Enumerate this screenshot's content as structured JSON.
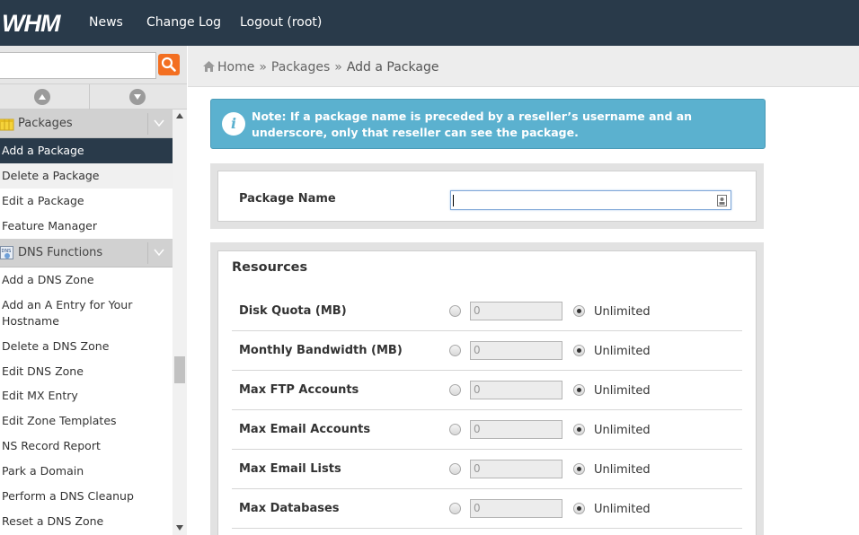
{
  "topbar": {
    "logo_text": "WHM",
    "nav": [
      "News",
      "Change Log",
      "Logout (root)"
    ]
  },
  "sidebar": {
    "search": {
      "value": "",
      "placeholder": ""
    },
    "groups": [
      {
        "label": "Packages",
        "icon": "packages-icon",
        "items": [
          "Add a Package",
          "Delete a Package",
          "Edit a Package",
          "Feature Manager"
        ]
      },
      {
        "label": "DNS Functions",
        "icon": "dns-icon",
        "icon_text": "DNS",
        "items": [
          "Add a DNS Zone",
          "Add an A Entry for Your Hostname",
          "Delete a DNS Zone",
          "Edit DNS Zone",
          "Edit MX Entry",
          "Edit Zone Templates",
          "NS Record Report",
          "Park a Domain",
          "Perform a DNS Cleanup",
          "Reset a DNS Zone"
        ]
      }
    ],
    "active_item": "Add a Package"
  },
  "breadcrumb": {
    "items": [
      "Home",
      "Packages",
      "Add a Package"
    ],
    "separator": "»"
  },
  "note": {
    "text": "Note: If a package name is preceded by a reseller’s username and an underscore, only that reseller can see the package."
  },
  "package_name": {
    "label": "Package Name",
    "value": ""
  },
  "resources": {
    "title": "Resources",
    "rows": [
      {
        "label": "Disk Quota (MB)",
        "value": "0",
        "unlimited_label": "Unlimited",
        "unlimited": true
      },
      {
        "label": "Monthly Bandwidth (MB)",
        "value": "0",
        "unlimited_label": "Unlimited",
        "unlimited": true
      },
      {
        "label": "Max FTP Accounts",
        "value": "0",
        "unlimited_label": "Unlimited",
        "unlimited": true
      },
      {
        "label": "Max Email Accounts",
        "value": "0",
        "unlimited_label": "Unlimited",
        "unlimited": true
      },
      {
        "label": "Max Email Lists",
        "value": "0",
        "unlimited_label": "Unlimited",
        "unlimited": true
      },
      {
        "label": "Max Databases",
        "value": "0",
        "unlimited_label": "Unlimited",
        "unlimited": true
      }
    ]
  },
  "colors": {
    "topbar": "#293a4a",
    "accent_orange": "#f36f21",
    "note_bg": "#5bb1cf"
  }
}
